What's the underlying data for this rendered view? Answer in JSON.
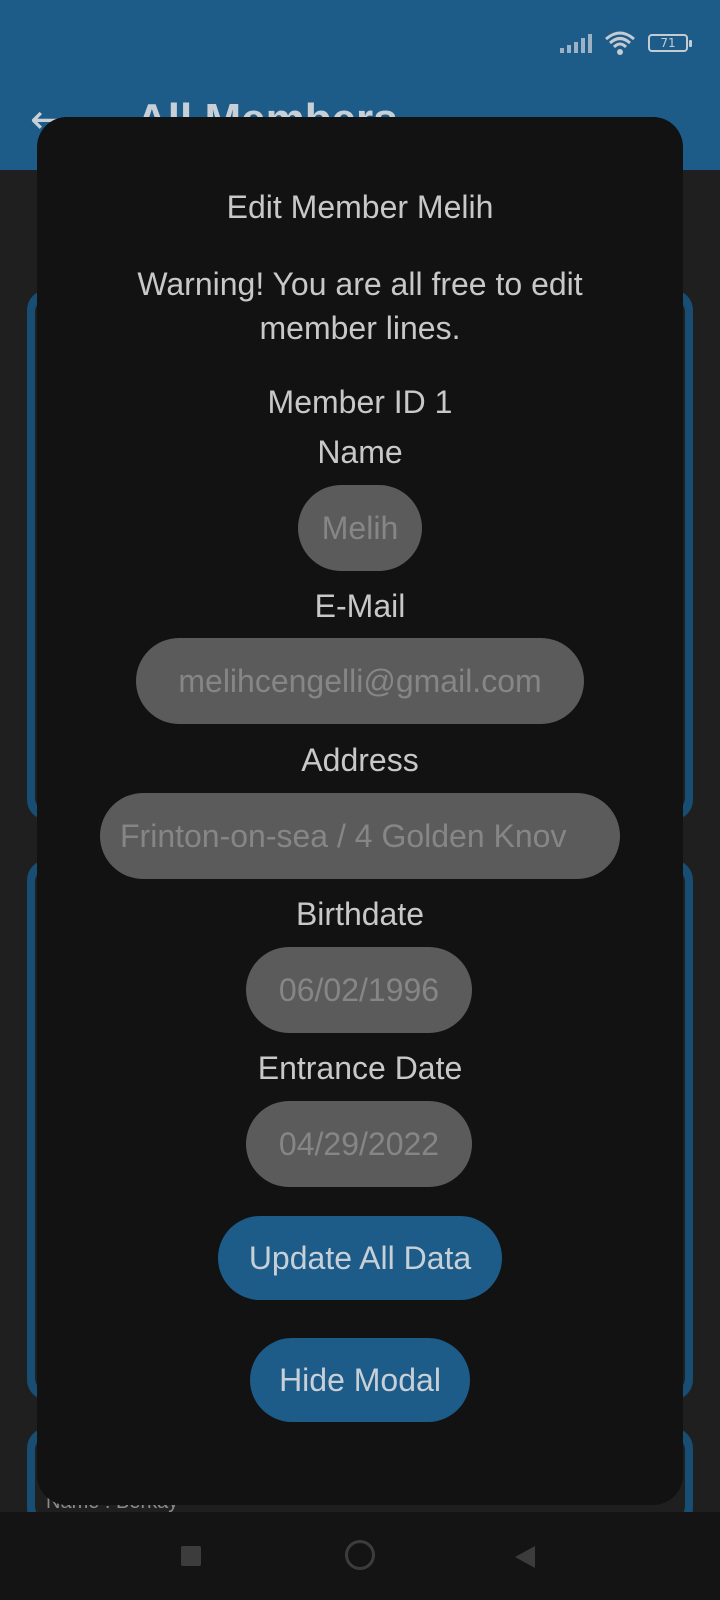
{
  "status_bar": {
    "battery_level": "71",
    "icons": [
      "signal-icon",
      "wifi-icon",
      "battery-icon"
    ]
  },
  "app_bar": {
    "back_icon": "arrow-left-icon",
    "title": "All Members"
  },
  "background_list": {
    "visible_label": "Name : Berkay"
  },
  "modal": {
    "title": "Edit Member Melih",
    "warning": "Warning! You are all free to edit member lines.",
    "member_id": "Member ID 1",
    "fields": {
      "name": {
        "label": "Name",
        "value": "Melih"
      },
      "email": {
        "label": "E-Mail",
        "value": "melihcengelli@gmail.com"
      },
      "address": {
        "label": "Address",
        "value": "Frinton-on-sea / 4 Golden Knov"
      },
      "birthdate": {
        "label": "Birthdate",
        "value": "06/02/1996"
      },
      "entrance_date": {
        "label": "Entrance Date",
        "value": "04/29/2022"
      }
    },
    "update_button": "Update All Data",
    "hide_button": "Hide Modal"
  },
  "colors": {
    "primary": "#1d5c89",
    "modal_bg": "#121212",
    "field_bg": "#5b5b5b"
  },
  "nav_bar": {
    "icons": [
      "recents-square-icon",
      "home-circle-icon",
      "back-triangle-icon"
    ]
  }
}
